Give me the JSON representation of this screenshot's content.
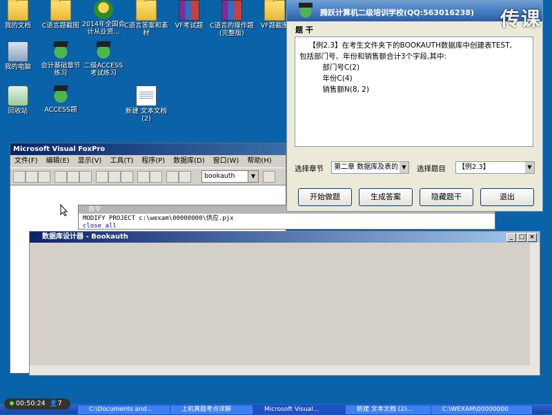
{
  "desktop": {
    "icons": [
      {
        "label": "我的文档",
        "kind": "folder"
      },
      {
        "label": "C语言题截图",
        "kind": "folder"
      },
      {
        "label": "2014年全国会计从业资...",
        "kind": "mushroom"
      },
      {
        "label": "C语言答案和素材",
        "kind": "folder"
      },
      {
        "label": "VF考试题",
        "kind": "winrar"
      },
      {
        "label": "C语言的操作题(完整版)",
        "kind": "winrar"
      },
      {
        "label": "VF题截图",
        "kind": "folder"
      },
      {
        "label": "我的电脑",
        "kind": "computer"
      },
      {
        "label": "会计基础章节练习",
        "kind": "frog"
      },
      {
        "label": "二级ACCESS考试练习",
        "kind": "frog"
      },
      {
        "label": "回收站",
        "kind": "recycle"
      },
      {
        "label": "ACCESS题",
        "kind": "frog"
      },
      {
        "label": "新建 文本文档 (2)",
        "kind": "notepad"
      }
    ]
  },
  "vfp": {
    "title": "Microsoft Visual FoxPro",
    "menu": [
      "文件(F)",
      "编辑(E)",
      "显示(V)",
      "工具(T)",
      "程序(P)",
      "数据库(D)",
      "窗口(W)",
      "帮助(H)"
    ],
    "db_combo": "bookauth"
  },
  "command": {
    "title": "命令",
    "lines": [
      "MODIFY PROJECT c:\\wexam\\00000000\\供应.pjx",
      "close all"
    ]
  },
  "designer": {
    "title": "数据库设计器 - Bookauth"
  },
  "dialog": {
    "title": "腾跃计算机二级培训学校(QQ:563016238)",
    "question_label": "题  干",
    "question_lines": [
      "    【例2.3】在考生文件夹下的BOOKAUTH数据库中创建表TEST,",
      "包括部门号、年份和销售额合计3个字段,其中:",
      "          部门号C(2)",
      "          年份C(4)",
      "          销售额N(8, 2)"
    ],
    "chapter_label": "选择章节",
    "chapter_value": "第二章  数据库及表的",
    "topic_label": "选择题目",
    "topic_value": "【例2.3】",
    "buttons": {
      "start": "开始做题",
      "generate": "生成答案",
      "hide": "隐藏题干",
      "exit": "退出"
    }
  },
  "watermark": "传课",
  "timer": {
    "time": "00:50:24",
    "viewers": "7"
  },
  "taskbar": {
    "items": [
      "C:\\Documents and...",
      "上机真题考点详解",
      "Microsoft Visual...",
      "新建 文本文档 (2)...",
      "C:\\WEXAM\\00000000"
    ]
  }
}
